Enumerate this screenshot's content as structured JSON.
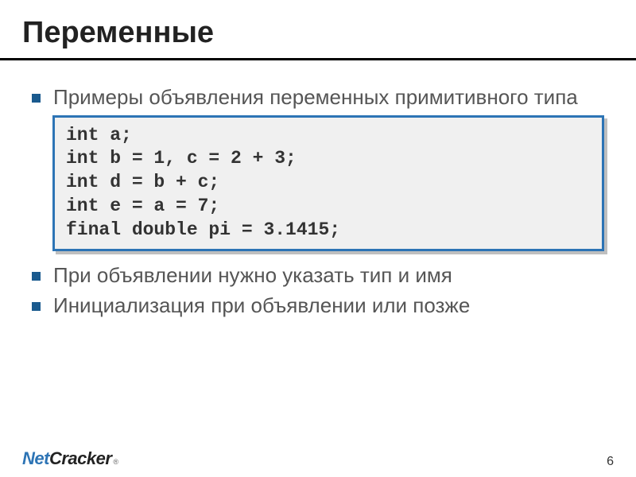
{
  "title": "Переменные",
  "bullets": [
    "Примеры объявления переменных примитивного типа",
    "При объявлении нужно указать тип и имя",
    "Инициализация при объявлении или позже"
  ],
  "code": "int a;\nint b = 1, c = 2 + 3;\nint d = b + c;\nint e = a = 7;\nfinal double pi = 3.1415;",
  "footer": {
    "logo_part1": "Net",
    "logo_part2": "Cracker",
    "logo_reg": "®",
    "page_number": "6"
  }
}
